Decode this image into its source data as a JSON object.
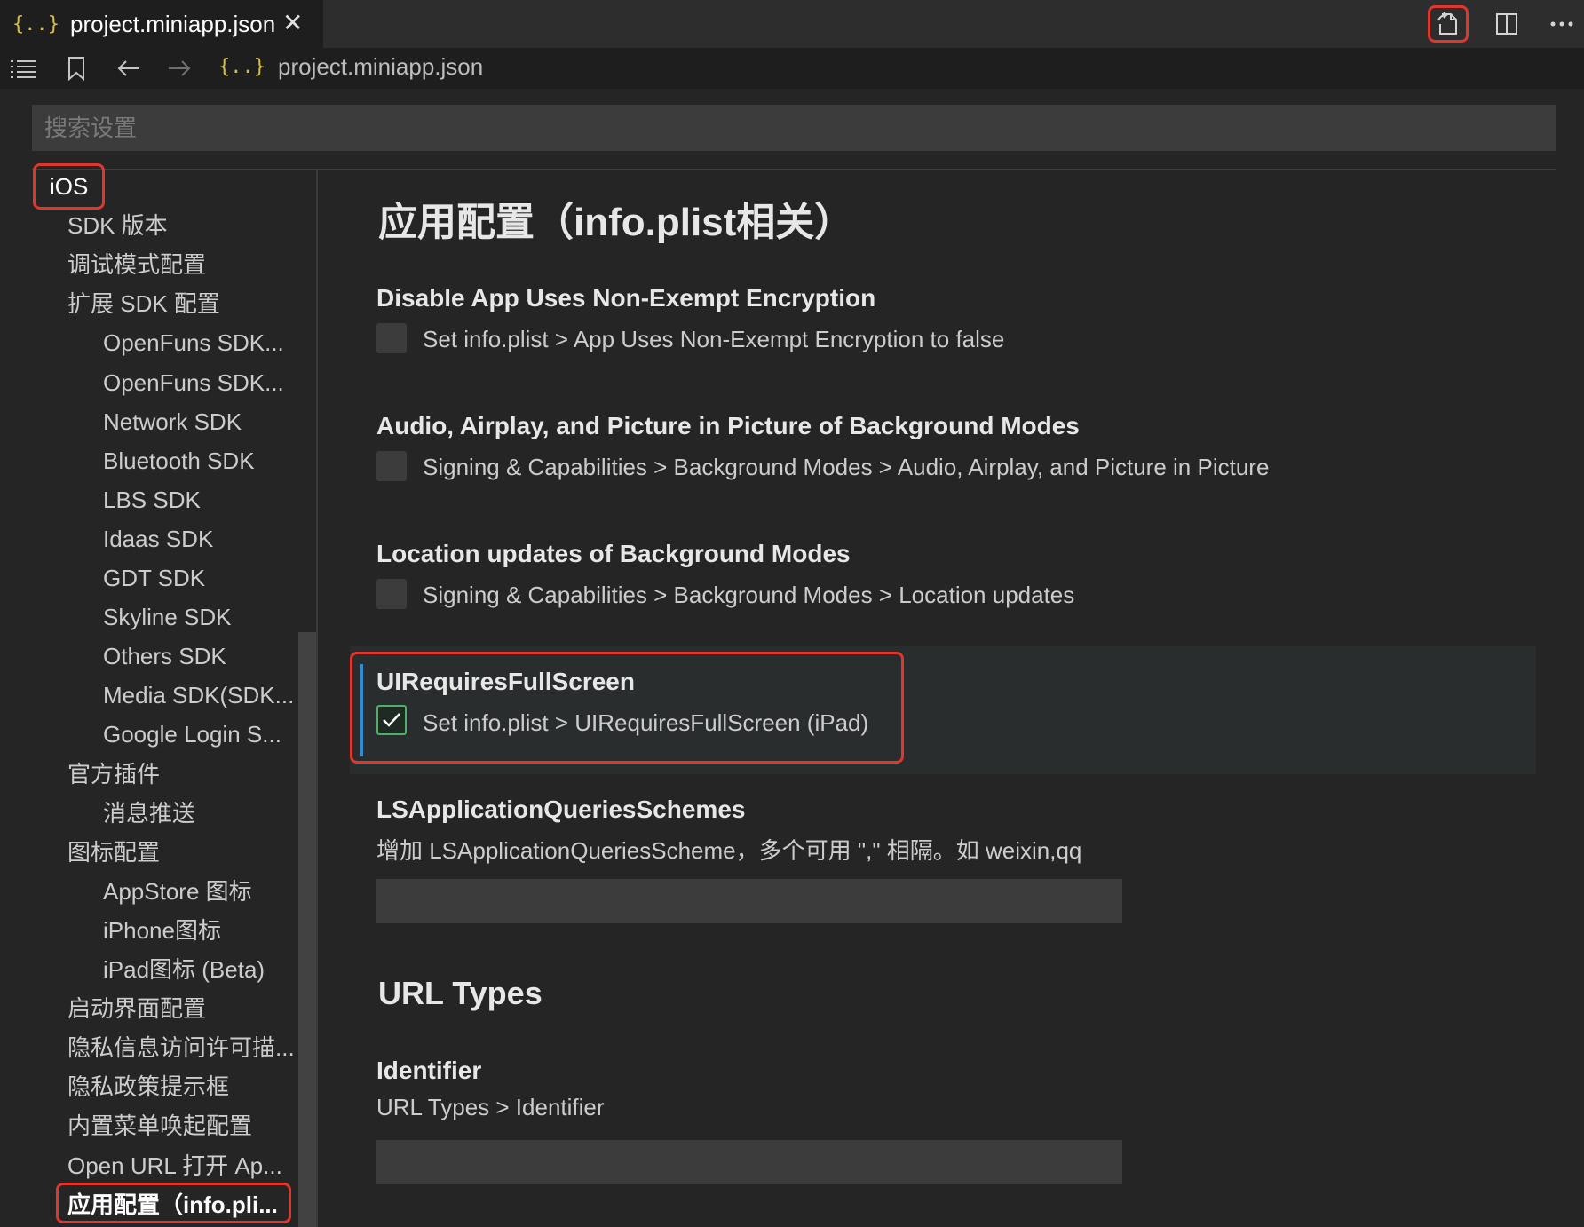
{
  "tab": {
    "braces": "{..}",
    "title": "project.miniapp.json",
    "close": "✕"
  },
  "breadcrumb": {
    "braces": "{..}",
    "file": "project.miniapp.json"
  },
  "search": {
    "placeholder": "搜索设置"
  },
  "toc": {
    "items": [
      {
        "label": "iOS",
        "level": 0
      },
      {
        "label": "SDK 版本",
        "level": 1
      },
      {
        "label": "调试模式配置",
        "level": 1
      },
      {
        "label": "扩展 SDK 配置",
        "level": 1
      },
      {
        "label": "OpenFuns SDK...",
        "level": 2
      },
      {
        "label": "OpenFuns SDK...",
        "level": 2
      },
      {
        "label": "Network SDK",
        "level": 2
      },
      {
        "label": "Bluetooth SDK",
        "level": 2
      },
      {
        "label": "LBS SDK",
        "level": 2
      },
      {
        "label": "Idaas SDK",
        "level": 2
      },
      {
        "label": "GDT SDK",
        "level": 2
      },
      {
        "label": "Skyline SDK",
        "level": 2
      },
      {
        "label": "Others SDK",
        "level": 2
      },
      {
        "label": "Media SDK(SDK...",
        "level": 2
      },
      {
        "label": "Google Login S...",
        "level": 2
      },
      {
        "label": "官方插件",
        "level": 1
      },
      {
        "label": "消息推送",
        "level": 2
      },
      {
        "label": "图标配置",
        "level": 1
      },
      {
        "label": "AppStore 图标",
        "level": 2
      },
      {
        "label": "iPhone图标",
        "level": 2
      },
      {
        "label": "iPad图标 (Beta)",
        "level": 2
      },
      {
        "label": "启动界面配置",
        "level": 1
      },
      {
        "label": "隐私信息访问许可描...",
        "level": 1
      },
      {
        "label": "隐私政策提示框",
        "level": 1
      },
      {
        "label": "内置菜单唤起配置",
        "level": 1
      },
      {
        "label": "Open URL 打开 Ap...",
        "level": 1
      },
      {
        "label": "应用配置（info.pli...",
        "level": 1,
        "active": true
      }
    ]
  },
  "main": {
    "page_title": "应用配置（info.plist相关）",
    "settings": [
      {
        "title": "Disable App Uses Non-Exempt Encryption",
        "desc": "Set info.plist > App Uses Non-Exempt Encryption to false",
        "checked": false
      },
      {
        "title": "Audio, Airplay, and Picture in Picture of Background Modes",
        "desc": "Signing & Capabilities > Background Modes > Audio, Airplay, and Picture in Picture",
        "checked": false
      },
      {
        "title": "Location updates of Background Modes",
        "desc": "Signing & Capabilities > Background Modes > Location updates",
        "checked": false
      },
      {
        "title": "UIRequiresFullScreen",
        "desc": "Set info.plist > UIRequiresFullScreen (iPad)",
        "checked": true
      }
    ],
    "ls_schemes": {
      "title": "LSApplicationQueriesSchemes",
      "desc": "增加 LSApplicationQueriesScheme，多个可用 \",\" 相隔。如 weixin,qq",
      "value": ""
    },
    "url_types": {
      "section_title": "URL Types",
      "identifier_title": "Identifier",
      "identifier_desc": "URL Types > Identifier",
      "identifier_value": ""
    }
  },
  "colors": {
    "highlight": "#e0362c",
    "check": "#4caf6a",
    "focus": "#2f8dd1"
  }
}
